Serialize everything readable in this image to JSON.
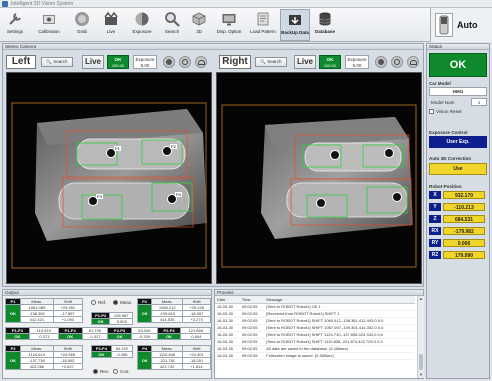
{
  "window": {
    "title": "Intelligent 3D Vision System"
  },
  "toolbar": {
    "items": [
      {
        "label": "Settings",
        "icon": "wrench-icon"
      },
      {
        "label": "Calibration",
        "icon": "calibration-icon"
      },
      {
        "label": "Grab",
        "icon": "grab-icon"
      },
      {
        "label": "Live",
        "icon": "live-icon"
      },
      {
        "label": "Exposure",
        "icon": "exposure-icon"
      },
      {
        "label": "Search",
        "icon": "search-icon"
      },
      {
        "label": "3D",
        "icon": "3d-icon"
      },
      {
        "label": "Disp. Option",
        "icon": "display-icon"
      },
      {
        "label": "Load Pattern",
        "icon": "pattern-icon"
      },
      {
        "label": "BackUp Data",
        "icon": "backup-icon"
      },
      {
        "label": "Database",
        "icon": "database-icon"
      }
    ],
    "auto_label": "Auto"
  },
  "stereo": {
    "section_title": "Stereo Camera",
    "left": {
      "label": "Left",
      "search": "Search",
      "live": "Live",
      "ok": "OK",
      "ok_value": "100.00",
      "exposure_label": "Exposure",
      "exposure_value": "5.00"
    },
    "right": {
      "label": "Right",
      "search": "Search",
      "live": "Live",
      "ok": "OK",
      "ok_value": "100.00",
      "exposure_label": "Exposure",
      "exposure_value": "5.00"
    },
    "markers": [
      "P1",
      "P2",
      "P3",
      "P4"
    ]
  },
  "status": {
    "section_title": "Status",
    "result": "OK",
    "car_model_label": "Car Model",
    "car_model": "HMI1",
    "model_num_label": "Model Num",
    "model_num": "1",
    "vision_reset": "Vision Reset",
    "exposure_control_label": "Exposure Control",
    "exposure_control": "User Exp.",
    "auto3d_label": "Auto 3D Correction",
    "auto3d": "Use",
    "robot_position_label": "Robot Position",
    "position": [
      {
        "axis": "X",
        "value": "932.170"
      },
      {
        "axis": "Y",
        "value": "-110.213"
      },
      {
        "axis": "Z",
        "value": "684.531"
      },
      {
        "axis": "RX",
        "value": "-179.982"
      },
      {
        "axis": "RY",
        "value": "0.006"
      },
      {
        "axis": "RZ",
        "value": "179.990"
      }
    ]
  },
  "output": {
    "section_title": "Output",
    "col_meas": "Meas.",
    "col_shift": "Shift",
    "ref_label": "Ref.",
    "meas_label": "Meas.",
    "rev_label": "Rev.",
    "corr_label": "Corr.",
    "p1": {
      "name": "P1",
      "meas": [
        "1061.089",
        "-138.392",
        "412.421"
      ],
      "shift": [
        "+24.951",
        "-17.857",
        "+1.093"
      ],
      "ok": "OK"
    },
    "p2": {
      "name": "P2",
      "meas": [
        "1068.212",
        "-109.615",
        "414.535"
      ],
      "shift": [
        "+25.228",
        "-18.457",
        "+3.273"
      ],
      "ok": "OK"
    },
    "p3": {
      "name": "P3",
      "meas": [
        "1124.614",
        "-137.738",
        "423.266"
      ],
      "shift": [
        "+24.565",
        "-18.592",
        "+2.627"
      ],
      "ok": "OK"
    },
    "p4": {
      "name": "P4",
      "meas": [
        "1110.846",
        "-221.781",
        "422.742"
      ],
      "shift": [
        "+24.301",
        "-18.291",
        "+1.814"
      ],
      "ok": "OK"
    },
    "d13": {
      "name": "P1-P3",
      "value": "119.519",
      "shift": "-0.371"
    },
    "d14": {
      "name": "P1-P4",
      "value": "61.739",
      "shift": "-0.327"
    },
    "d23": {
      "name": "P2-P3",
      "value": "63.026",
      "shift": "-0.339"
    },
    "d24": {
      "name": "P2-P4",
      "value": "121.668",
      "shift": "-0.604"
    },
    "d12": {
      "name": "P1-P2",
      "value": "128.987",
      "shift": "-0.503"
    },
    "d34": {
      "name": "P3-P4",
      "value": "84.192",
      "shift": "-0.266"
    }
  },
  "process": {
    "section_title": "Process",
    "columns": [
      "Date",
      "Time",
      "Message"
    ],
    "rows": [
      [
        "16-03-30",
        "09:02:05",
        "[Sent to ROBOT Robot1] OK 1"
      ],
      [
        "16-03-30",
        "09:02:05",
        "[Received from ROBOT Robot1] SHIFT 1"
      ],
      [
        "16-03-30",
        "09:02:05",
        "[Sent to ROBOT Robot1] SHIFT 1060.912,-138.361,412.493,0.0,0"
      ],
      [
        "16-03-30",
        "09:02:05",
        "[Sent to ROBOT Robot1] SHIFT 1067.097,-109.301,414.302,0.0,0"
      ],
      [
        "16-03-30",
        "09:02:05",
        "[Sent to ROBOT Robot1] SHIFT 1124.710,-137.658,423.334,0.0,0"
      ],
      [
        "16-03-30",
        "09:02:05",
        "[Sent to ROBOT Robot1] SHIFT 1110.835,-221.874,422.709,0.0,0"
      ],
      [
        "16-03-30",
        "09:02:05",
        "All data are saved to the database. (0.188sec)"
      ],
      [
        "16-03-30",
        "09:02:05",
        "Fullscreen image is saved. (0.365sec)"
      ]
    ]
  }
}
